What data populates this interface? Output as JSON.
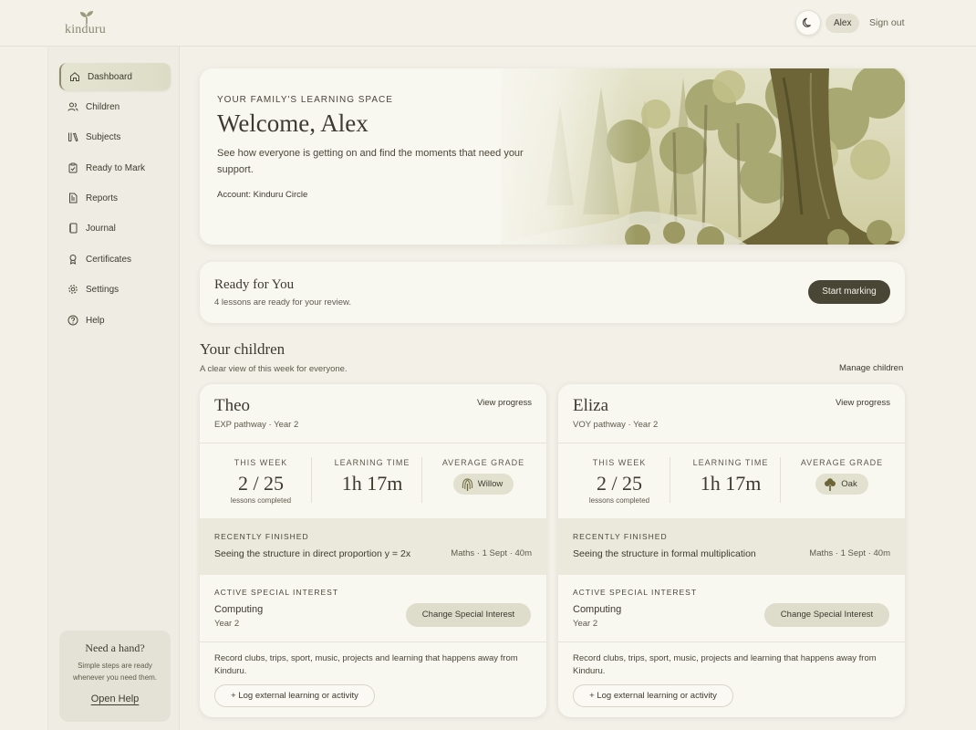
{
  "brand": {
    "name": "kinduru"
  },
  "header": {
    "user": "Alex",
    "signout": "Sign out"
  },
  "sidebar": {
    "items": [
      {
        "label": "Dashboard",
        "icon": "home-icon"
      },
      {
        "label": "Children",
        "icon": "users-icon"
      },
      {
        "label": "Subjects",
        "icon": "books-icon"
      },
      {
        "label": "Ready to Mark",
        "icon": "clipboard-check-icon"
      },
      {
        "label": "Reports",
        "icon": "document-icon"
      },
      {
        "label": "Journal",
        "icon": "notebook-icon"
      },
      {
        "label": "Certificates",
        "icon": "award-icon"
      },
      {
        "label": "Settings",
        "icon": "gear-icon"
      },
      {
        "label": "Help",
        "icon": "help-circle-icon"
      }
    ],
    "help": {
      "title": "Need a hand?",
      "desc": "Simple steps are ready whenever you need them.",
      "link": "Open Help"
    }
  },
  "hero": {
    "eyebrow": "YOUR FAMILY'S LEARNING SPACE",
    "title": "Welcome, Alex",
    "desc": "See how everyone is getting on and find the moments that need your support.",
    "account": "Account: Kinduru Circle"
  },
  "ready": {
    "title": "Ready for You",
    "desc": "4 lessons are ready for your review.",
    "button": "Start marking"
  },
  "children_section": {
    "title": "Your children",
    "subtitle": "A clear view of this week for everyone.",
    "manage": "Manage children"
  },
  "children": [
    {
      "name": "Theo",
      "pathway": "EXP pathway · Year 2",
      "view": "View progress",
      "week_label": "THIS WEEK",
      "week_value": "2 / 25",
      "week_sub": "lessons completed",
      "time_label": "LEARNING TIME",
      "time_value": "1h 17m",
      "grade_label": "AVERAGE GRADE",
      "grade": "Willow",
      "recent_label": "RECENTLY FINISHED",
      "recent_title": "Seeing the structure in direct proportion y = 2x",
      "recent_meta": "Maths · 1 Sept · 40m",
      "interest_label": "ACTIVE SPECIAL INTEREST",
      "interest": "Computing",
      "interest_year": "Year 2",
      "interest_button": "Change Special Interest",
      "external_text": "Record clubs, trips, sport, music, projects and learning that happens away from Kinduru.",
      "log_button": "+ Log external learning or activity"
    },
    {
      "name": "Eliza",
      "pathway": "VOY pathway · Year 2",
      "view": "View progress",
      "week_label": "THIS WEEK",
      "week_value": "2 / 25",
      "week_sub": "lessons completed",
      "time_label": "LEARNING TIME",
      "time_value": "1h 17m",
      "grade_label": "AVERAGE GRADE",
      "grade": "Oak",
      "recent_label": "RECENTLY FINISHED",
      "recent_title": "Seeing the structure in formal multiplication",
      "recent_meta": "Maths · 1 Sept · 40m",
      "interest_label": "ACTIVE SPECIAL INTEREST",
      "interest": "Computing",
      "interest_year": "Year 2",
      "interest_button": "Change Special Interest",
      "external_text": "Record clubs, trips, sport, music, projects and learning that happens away from Kinduru.",
      "log_button": "+ Log external learning or activity"
    }
  ]
}
